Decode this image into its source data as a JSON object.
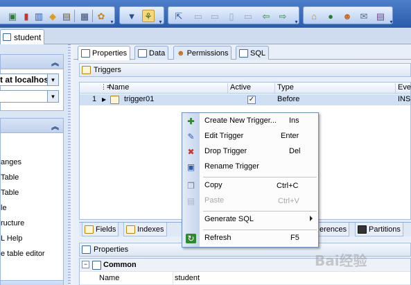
{
  "document_tab": {
    "label": "student"
  },
  "left_panel": {
    "connection_combo": "t at localhos",
    "items": [
      "anges",
      " Table",
      "Table",
      "le",
      "ructure",
      "L Help",
      "e table editor"
    ]
  },
  "sub_tabs": [
    "Properties",
    "Data",
    "Permissions",
    "SQL"
  ],
  "triggers_section": {
    "title": "Triggers"
  },
  "grid": {
    "columns": [
      "Name",
      "Active",
      "Type",
      "Eve"
    ],
    "rows": [
      {
        "num": "1",
        "name": "trigger01",
        "active": "✓",
        "type": "Before",
        "event": "INSE"
      }
    ]
  },
  "bottom_tabs": [
    "Fields",
    "Indexes",
    "erences",
    "Partitions"
  ],
  "properties_section": {
    "title": "Properties",
    "group": "Common",
    "rows": [
      {
        "key": "Name",
        "value": "student"
      }
    ]
  },
  "context_menu": {
    "items": [
      {
        "label": "Create New Trigger...",
        "shortcut": "Ins"
      },
      {
        "label": "Edit Trigger",
        "shortcut": "Enter"
      },
      {
        "label": "Drop Trigger",
        "shortcut": "Del"
      },
      {
        "label": "Rename Trigger",
        "shortcut": ""
      },
      {
        "label": "Copy",
        "shortcut": "Ctrl+C"
      },
      {
        "label": "Paste",
        "shortcut": "Ctrl+V"
      },
      {
        "label": "Generate SQL",
        "shortcut": ""
      },
      {
        "label": "Refresh",
        "shortcut": "F5"
      }
    ]
  },
  "watermark": "Bai经验",
  "colors": {
    "toolbar": "#2a5cae",
    "selection": "#cfe0f4",
    "menu_border": "#6d8ebf"
  }
}
